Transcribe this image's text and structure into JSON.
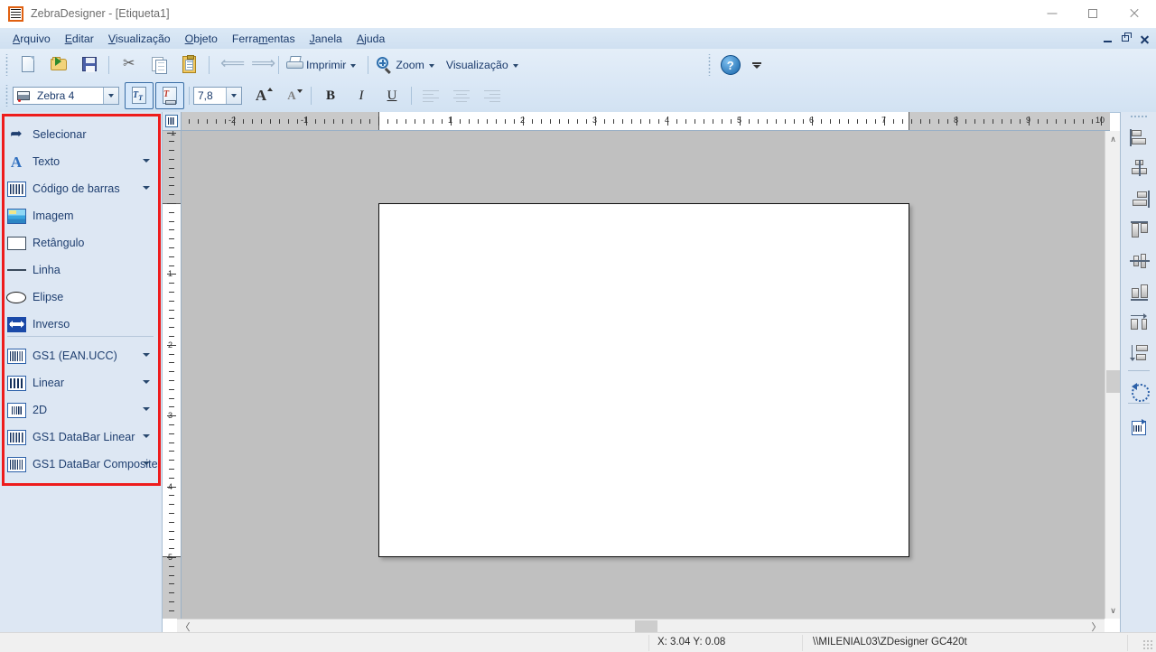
{
  "window": {
    "title": "ZebraDesigner - [Etiqueta1]",
    "icon": "zebra-printer-icon",
    "minimize": "—",
    "maximize": "□",
    "close": "✕"
  },
  "menubar": {
    "items": [
      {
        "label": "Arquivo",
        "accel": "A"
      },
      {
        "label": "Editar",
        "accel": "E"
      },
      {
        "label": "Visualização",
        "accel": "V"
      },
      {
        "label": "Objeto",
        "accel": "O"
      },
      {
        "label": "Ferramentas",
        "accel": "m"
      },
      {
        "label": "Janela",
        "accel": "J"
      },
      {
        "label": "Ajuda",
        "accel": "A"
      }
    ],
    "mdi": {
      "minimize": "mdi-minimize",
      "restore": "mdi-restore",
      "close": "mdi-close"
    }
  },
  "toolbar_main": {
    "buttons": [
      {
        "name": "new-document-button",
        "icon": "new-document-icon",
        "label": ""
      },
      {
        "name": "open-document-button",
        "icon": "open-folder-icon",
        "label": ""
      },
      {
        "name": "save-document-button",
        "icon": "floppy-disk-icon",
        "label": ""
      },
      {
        "name": "cut-button",
        "icon": "scissors-icon",
        "label": ""
      },
      {
        "name": "copy-button",
        "icon": "copy-icon",
        "label": ""
      },
      {
        "name": "paste-button",
        "icon": "clipboard-icon",
        "label": ""
      },
      {
        "name": "undo-button",
        "icon": "undo-arrow-icon",
        "label": ""
      },
      {
        "name": "redo-button",
        "icon": "redo-arrow-icon",
        "label": ""
      }
    ],
    "print_label": "Imprimir",
    "zoom_label": "Zoom",
    "view_label": "Visualização",
    "help_icon": "?",
    "overflow": "toolbar-overflow-chevron"
  },
  "toolbar_format": {
    "printer_font": "Zebra 4",
    "font_size": "7,8",
    "internal_font_toggle": "internal-printer-font-button",
    "printer_font_toggle": "printer-font-button",
    "grow_font": "A",
    "shrink_font": "A",
    "bold": "B",
    "italic": "I",
    "underline": "U",
    "align_left": "align-left-button",
    "align_center": "align-center-button",
    "align_right": "align-right-button"
  },
  "toolbox": {
    "items": [
      {
        "label": "Selecionar",
        "icon": "arrow-cursor-icon",
        "dropdown": false
      },
      {
        "label": "Texto",
        "icon": "text-a-icon",
        "dropdown": true
      },
      {
        "label": "Código de barras",
        "icon": "barcode-icon",
        "dropdown": true
      },
      {
        "label": "Imagem",
        "icon": "picture-icon",
        "dropdown": false
      },
      {
        "label": "Retângulo",
        "icon": "rectangle-icon",
        "dropdown": false
      },
      {
        "label": "Linha",
        "icon": "line-icon",
        "dropdown": false
      },
      {
        "label": "Elipse",
        "icon": "ellipse-icon",
        "dropdown": false
      },
      {
        "label": "Inverso",
        "icon": "inverse-icon",
        "dropdown": false
      },
      {
        "label": "GS1 (EAN.UCC)",
        "icon": "gs1-barcode-icon",
        "dropdown": true
      },
      {
        "label": "Linear",
        "icon": "linear-barcode-icon",
        "dropdown": true
      },
      {
        "label": "2D",
        "icon": "datamatrix-2d-icon",
        "dropdown": true
      },
      {
        "label": "GS1 DataBar Linear",
        "icon": "databar-linear-icon",
        "dropdown": true
      },
      {
        "label": "GS1 DataBar Composite",
        "icon": "databar-composite-icon",
        "dropdown": true
      }
    ],
    "highlight_color": "#ee1c1c"
  },
  "rightbar": {
    "buttons": [
      {
        "name": "align-left-objects-button",
        "icon": "align-objects-left-icon"
      },
      {
        "name": "align-center-objects-button",
        "icon": "align-objects-center-icon"
      },
      {
        "name": "align-right-objects-button",
        "icon": "align-objects-right-icon"
      },
      {
        "name": "align-top-objects-button",
        "icon": "align-objects-top-icon"
      },
      {
        "name": "align-middle-objects-button",
        "icon": "align-objects-middle-icon"
      },
      {
        "name": "align-bottom-objects-button",
        "icon": "align-objects-bottom-icon"
      },
      {
        "name": "space-horizontally-button",
        "icon": "distribute-horizontal-icon"
      },
      {
        "name": "space-vertically-button",
        "icon": "distribute-vertical-icon"
      },
      {
        "name": "rotate-button",
        "icon": "rotate-ccw-icon"
      },
      {
        "name": "label-setup-button",
        "icon": "label-properties-icon"
      }
    ]
  },
  "rulers": {
    "horizontal": {
      "labels": [
        "-2",
        "-1",
        "1",
        "2",
        "3",
        "4",
        "5",
        "6",
        "7",
        "8",
        "9",
        "10"
      ],
      "unit": "in",
      "page_start": "0",
      "page_end": "7.3"
    },
    "vertical": {
      "labels": [
        "-1",
        "1",
        "2",
        "3",
        "4",
        "5",
        "6"
      ],
      "unit": "in",
      "page_start": "0",
      "page_end": "5"
    }
  },
  "canvas": {
    "label_name": "Etiqueta1",
    "label_background": "#ffffff",
    "workspace_background": "#c0c0c0"
  },
  "scrollbars": {
    "v_up": "∧",
    "v_down": "∨",
    "h_left": "〈",
    "h_right": "〉"
  },
  "statusbar": {
    "coordinates": "X:  3.04 Y:  0.08",
    "printer": "\\\\MILENIAL03\\ZDesigner GC420t"
  }
}
